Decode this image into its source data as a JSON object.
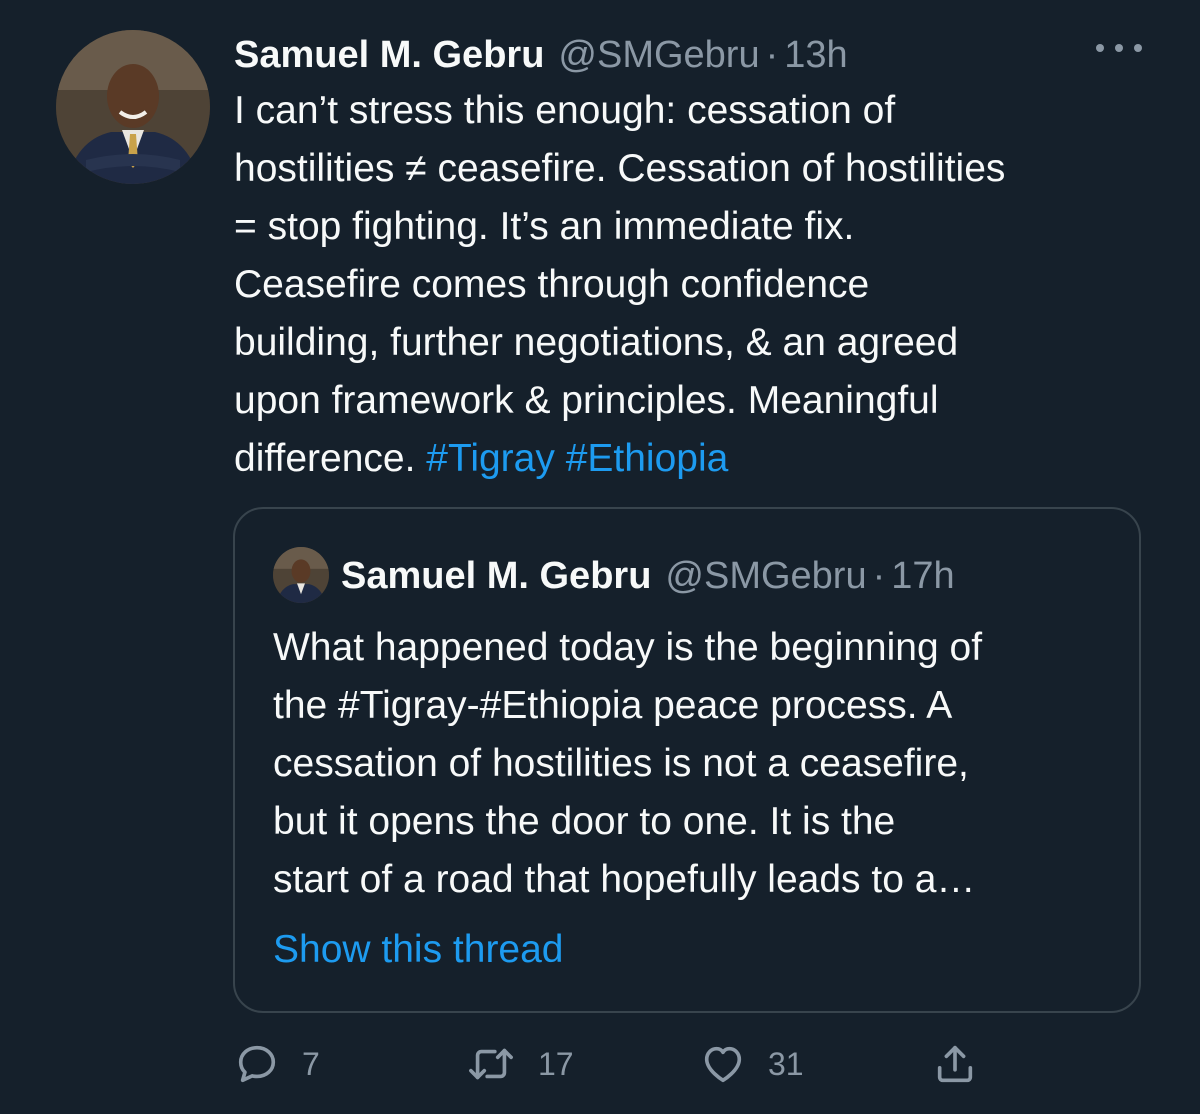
{
  "tweet": {
    "author_name": "Samuel M. Gebru",
    "author_handle": "@SMGebru",
    "separator": "·",
    "time": "13h",
    "text_lines": [
      "I can’t stress this enough: cessation of",
      "hostilities ≠ ceasefire. Cessation of hostilities",
      "= stop fighting. It’s an immediate fix.",
      "Ceasefire comes through confidence",
      "building, further negotiations, & an agreed",
      "upon framework & principles. Meaningful"
    ],
    "last_line_text": "difference. ",
    "hashtags": [
      "#Tigray",
      "#Ethiopia"
    ]
  },
  "quoted_tweet": {
    "author_name": "Samuel M. Gebru",
    "author_handle": "@SMGebru",
    "separator": "·",
    "time": "17h",
    "text_lines": [
      "What happened today is the beginning of",
      "the #Tigray-#Ethiopia peace process. A",
      "cessation of hostilities is not a ceasefire,",
      "but it opens the door to one. It is the",
      "start of a road that hopefully leads to a…"
    ],
    "show_thread_label": "Show this thread"
  },
  "actions": {
    "replies": "7",
    "retweets": "17",
    "likes": "31"
  },
  "icons": {
    "more": "more-horizontal-icon",
    "reply": "reply-icon",
    "retweet": "retweet-icon",
    "like": "heart-icon",
    "share": "share-icon"
  },
  "colors": {
    "background": "#15202b",
    "text": "#f7f9f9",
    "secondary": "#8b98a5",
    "link": "#1d9bf0",
    "border": "#38444d"
  }
}
